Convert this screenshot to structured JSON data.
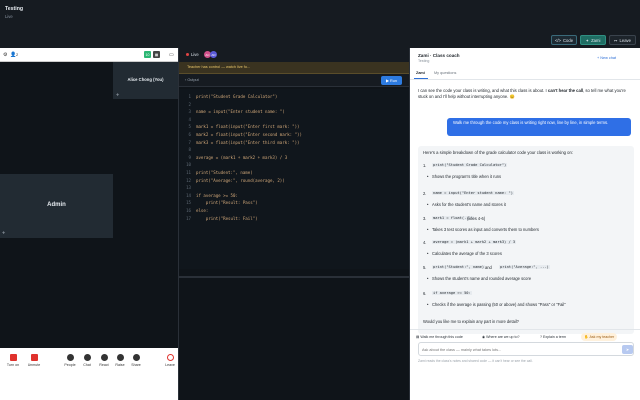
{
  "header": {
    "title": "Testing",
    "subtitle": "Live",
    "buttons": {
      "code": "Code",
      "zami": "Zami",
      "leave": "Leave"
    }
  },
  "video": {
    "toolbar_count": "2",
    "badge_a": "10",
    "participants": {
      "alice": "Alice Chong (You)",
      "admin": "Admin"
    },
    "controls": [
      {
        "label": "Turn on"
      },
      {
        "label": "Unmute"
      },
      {
        "label": "People"
      },
      {
        "label": "Chat"
      },
      {
        "label": "React"
      },
      {
        "label": "Raise"
      },
      {
        "label": "Share"
      },
      {
        "label": "Leave"
      }
    ]
  },
  "editor": {
    "live_label": "Live",
    "avatar_a": "AC",
    "avatar_b": "AD",
    "notice": "Teacher has control — watch live fo...",
    "output_label": "Output",
    "run_label": "Run",
    "lines": [
      "print(\"Student Grade Calculator\")",
      "",
      "name = input(\"Enter student name: \")",
      "",
      "mark1 = float(input(\"Enter first mark: \"))",
      "mark2 = float(input(\"Enter second mark: \"))",
      "mark3 = float(input(\"Enter third mark: \"))",
      "",
      "average = (mark1 + mark2 + mark3) / 3",
      "",
      "print(\"Student:\", name)",
      "print(\"Average:\", round(average, 2))",
      "",
      "if average >= 50:",
      "    print(\"Result: Pass\")",
      "else:",
      "    print(\"Result: Fail\")"
    ]
  },
  "coach": {
    "title": "Zami · Class coach",
    "subtitle": "Testing",
    "new_chat": "+ New chat",
    "tabs": [
      "Zami",
      "My questions"
    ],
    "ai_intro_pre": "I can see the code your class is writing, and what this class is about. I ",
    "ai_intro_bold": "can't hear the call",
    "ai_intro_post": ", so tell me what you're stuck on and I'll help without interrupting anyone. 😊",
    "user_msg": "Walk me through the code my class is writing right now, line by line, in simple terms.",
    "breakdown_intro": "Here's a simple breakdown of the grade calculator code your class is working on:",
    "steps": [
      {
        "n": "1.",
        "code": "print(\"Student Grade Calculator\")",
        "rest": "",
        "bullet": "Shows the program's title when it runs"
      },
      {
        "n": "2.",
        "code": "name = input(\"Enter student name: \")",
        "rest": "",
        "bullet": "Asks for the student's name and stores it"
      },
      {
        "n": "3.",
        "code": "mark1 = float(...)",
        "rest": " (lines 4-6)",
        "bullet": "Takes 3 test scores as input and converts them to numbers"
      },
      {
        "n": "4.",
        "code": "average = (mark1 + mark2 + mark3) / 3",
        "rest": "",
        "bullet": "Calculates the average of the 3 scores"
      },
      {
        "n": "5.",
        "code": "print(\"Student:\", name)",
        "rest": " and ",
        "code2": "print(\"Average:\", ...)",
        "bullet": "Shows the student's name and rounded average score"
      },
      {
        "n": "6.",
        "code": "if average >= 50:",
        "rest": "",
        "bullet": "Checks if the average is passing (50 or above) and shows \"Pass\" or \"Fail\""
      }
    ],
    "closing": "Would you like me to explain any part in more detail?",
    "chips": [
      "Walk me through this code",
      "Where are we up to?",
      "Explain a term",
      "Ask my teacher"
    ],
    "input_placeholder": "Ask about the class — mainly what takes lots...",
    "footer": "Zami reads the class's notes and shared code — it can't hear or see the call."
  }
}
